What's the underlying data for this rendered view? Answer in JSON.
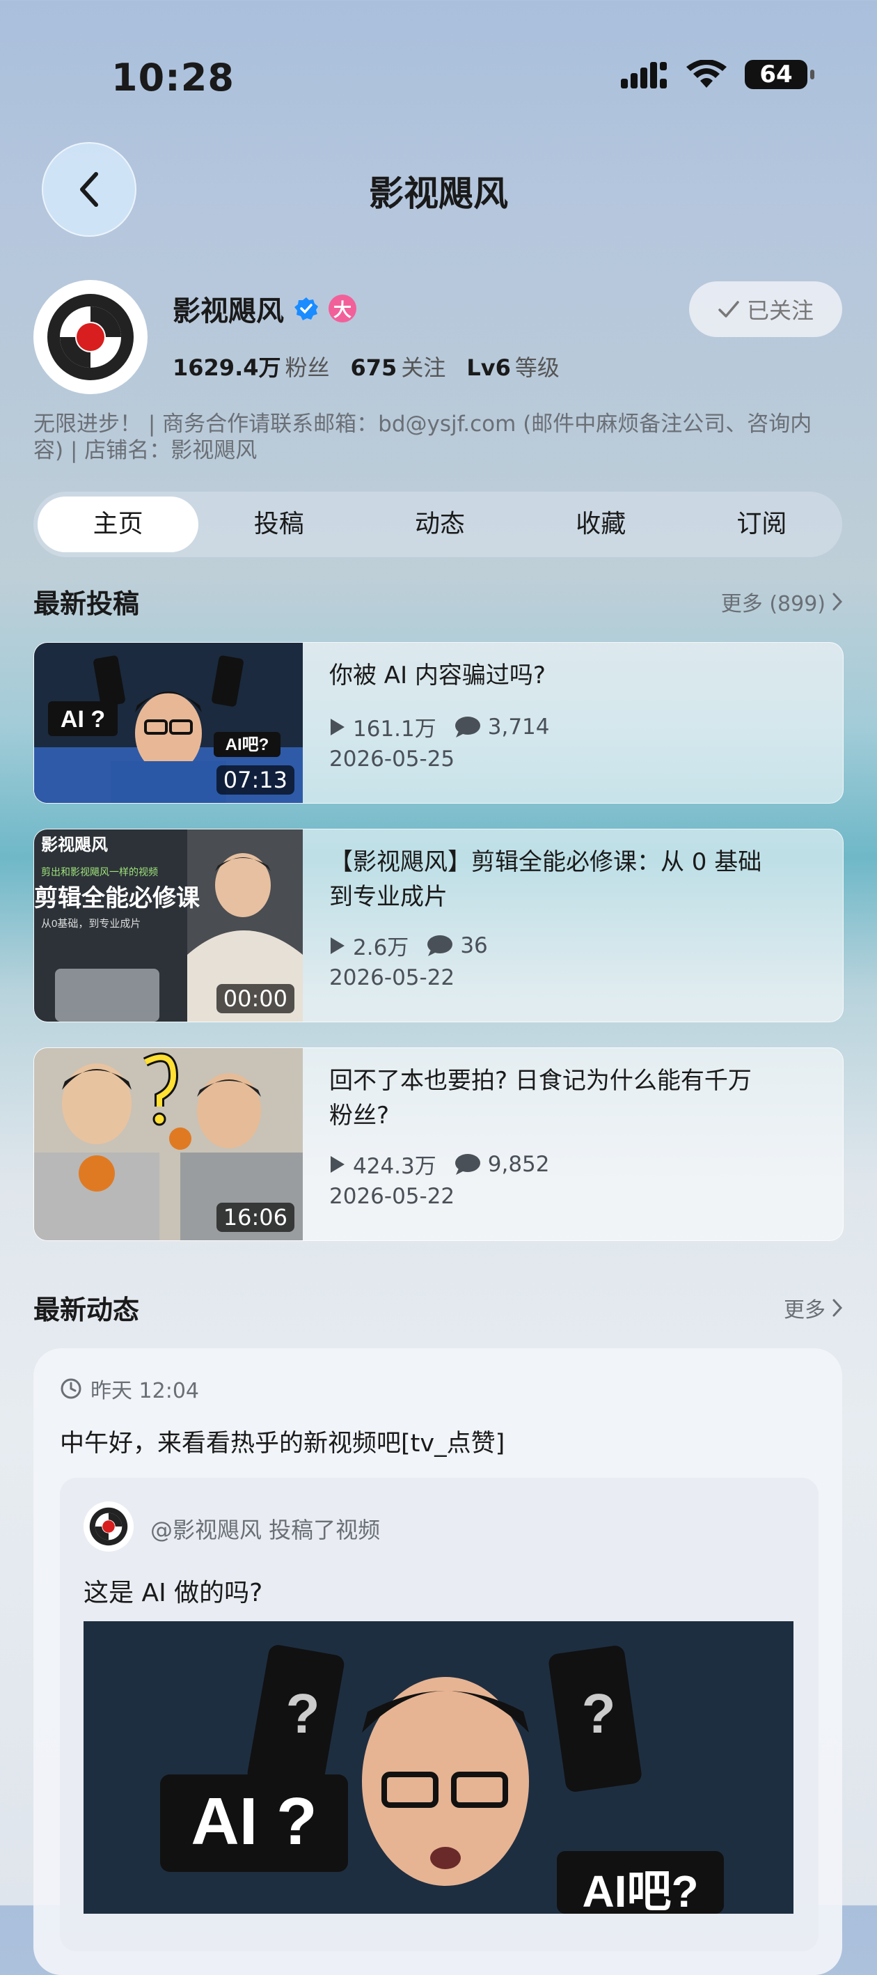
{
  "status_bar": {
    "time": "10:28",
    "battery": "64"
  },
  "header": {
    "title": "影视飓风"
  },
  "profile": {
    "name": "影视飓风",
    "vip_badge": "大",
    "followers_value": "1629.4万",
    "followers_label": "粉丝",
    "following_value": "675",
    "following_label": "关注",
    "level_value": "Lv6",
    "level_label": "等级",
    "follow_button": "已关注",
    "bio": "无限进步！ | 商务合作请联系邮箱：bd@ysjf.com (邮件中麻烦备注公司、咨询内容) | 店铺名：影视飓风"
  },
  "tabs": [
    "主页",
    "投稿",
    "动态",
    "收藏",
    "订阅"
  ],
  "latest_videos": {
    "title": "最新投稿",
    "more": "更多 (899)",
    "items": [
      {
        "title": "你被 AI 内容骗过吗?",
        "views": "161.1万",
        "comments": "3,714",
        "date": "2026-05-25",
        "duration": "07:13"
      },
      {
        "title": "【影视飓风】剪辑全能必修课：从 0 基础到专业成片",
        "views": "2.6万",
        "comments": "36",
        "date": "2026-05-22",
        "duration": "00:00"
      },
      {
        "title": "回不了本也要拍? 日食记为什么能有千万粉丝?",
        "views": "424.3万",
        "comments": "9,852",
        "date": "2026-05-22",
        "duration": "16:06"
      }
    ]
  },
  "latest_dynamics": {
    "title": "最新动态",
    "more": "更多",
    "time": "昨天 12:04",
    "text": "中午好，来看看热乎的新视频吧[tv_点赞]",
    "inner_by": "@影视飓风   投稿了视频",
    "inner_title": "这是 AI 做的吗?"
  },
  "thumbnail_text": {
    "v1_left": "AI ?",
    "v1_right": "AI吧?",
    "v2_brand": "影视飓风",
    "v2_small": "剪出和影视飓风一样的视频",
    "v2_big": "剪辑全能必修课",
    "v2_sub": "从0基础，到专业成片",
    "big_left": "AI ?",
    "big_right": "AI吧?"
  },
  "colors": {
    "accent_blue": "#1a8cff",
    "vip_pink": "#f2609a"
  }
}
